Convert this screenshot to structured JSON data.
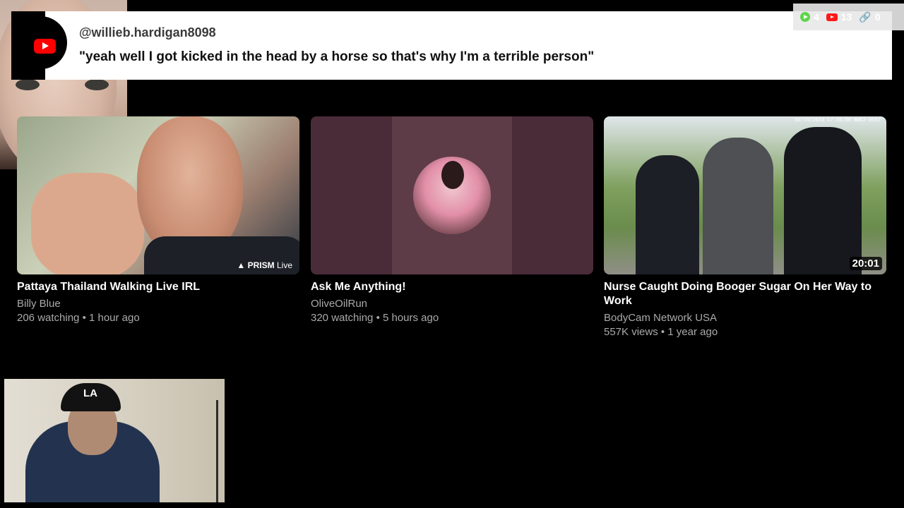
{
  "comment": {
    "username": "@willieb.hardigan8098",
    "text": "\"yeah well I got kicked in the head by a horse so that's why I'm a terrible person\""
  },
  "stats": {
    "viewers": "4",
    "youtube_count": "13",
    "links": "0",
    "icons": [
      "play-icon",
      "youtube-icon",
      "link-icon"
    ]
  },
  "videos": [
    {
      "title": "Pattaya Thailand Walking Live IRL",
      "channel": "Billy Blue",
      "meta": "206 watching • 1 hour ago",
      "overlay": "PRISM",
      "overlay_suffix": "Live"
    },
    {
      "title": "Ask Me Anything!",
      "channel": "OliveOilRun",
      "meta": "320 watching • 5 hours ago"
    },
    {
      "title": "Nurse Caught Doing Booger Sugar On Her Way to Work",
      "channel": "BodyCam Network USA",
      "meta": "557K views • 1 year ago",
      "duration": "20:01",
      "stamp": "06/19/2024 17:56:00   BWC2-0597"
    }
  ],
  "colors": {
    "background": "#000000",
    "banner": "#ffffff",
    "youtube_red": "#ff0000",
    "accent_green": "#4cd137",
    "meta_text": "#aaaaaa"
  },
  "webcam_bottom": {
    "cap_logo": "LA"
  }
}
